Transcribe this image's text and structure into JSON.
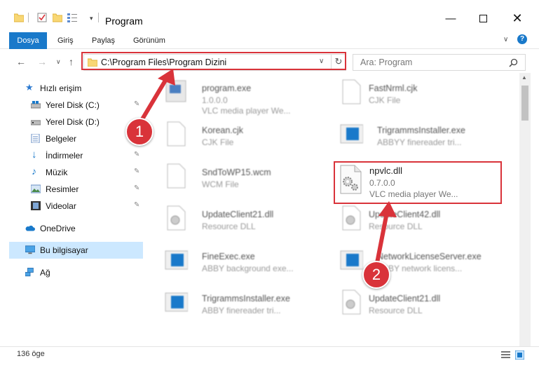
{
  "window": {
    "title": "Program"
  },
  "ribbon": {
    "tabs": [
      "Dosya",
      "Giriş",
      "Paylaş",
      "Görünüm"
    ]
  },
  "address": {
    "path": "C:\\Program Files\\Program Dizini"
  },
  "search": {
    "placeholder": "Ara: Program"
  },
  "sidebar": {
    "items": [
      {
        "label": "Hızlı erişim"
      },
      {
        "label": "Yerel Disk (C:)"
      },
      {
        "label": "Yerel Disk (D:)"
      },
      {
        "label": "Belgeler"
      },
      {
        "label": "İndirmeler"
      },
      {
        "label": "Müzik"
      },
      {
        "label": "Resimler"
      },
      {
        "label": "Videolar"
      },
      {
        "label": "OneDrive"
      },
      {
        "label": "Bu bilgisayar"
      },
      {
        "label": "Ağ"
      }
    ]
  },
  "files": [
    {
      "name": "program.exe",
      "type": "1.0.0.0",
      "desc": "VLC media player We..."
    },
    {
      "name": "FastNrml.cjk",
      "type": "CJK File",
      "desc": ""
    },
    {
      "name": "Korean.cjk",
      "type": "CJK File",
      "desc": ""
    },
    {
      "name": "TrigrammsInstaller.exe",
      "type": "ABBYY finereader tri...",
      "desc": ""
    },
    {
      "name": "SndToWP15.wcm",
      "type": "WCM File",
      "desc": ""
    },
    {
      "name": "npvlc.dll",
      "type": "0.7.0.0",
      "desc": "VLC media player We..."
    },
    {
      "name": "UpdateClient21.dll",
      "type": "Resource DLL",
      "desc": ""
    },
    {
      "name": "UpdateClient42.dll",
      "type": "Resource DLL",
      "desc": ""
    },
    {
      "name": "FineExec.exe",
      "type": "ABBY background exe...",
      "desc": ""
    },
    {
      "name": "NetworkLicenseServer.exe",
      "type": "ABBY network licens...",
      "desc": ""
    },
    {
      "name": "TrigrammsInstaller.exe",
      "type": "ABBY finereader tri...",
      "desc": ""
    },
    {
      "name": "UpdateClient21.dll",
      "type": "Resource DLL",
      "desc": ""
    }
  ],
  "markers": [
    "1",
    "2"
  ],
  "status": {
    "count": "136 öge"
  },
  "colors": {
    "accent": "#1979ca",
    "highlight": "#d9333a",
    "selected": "#cce8ff"
  }
}
